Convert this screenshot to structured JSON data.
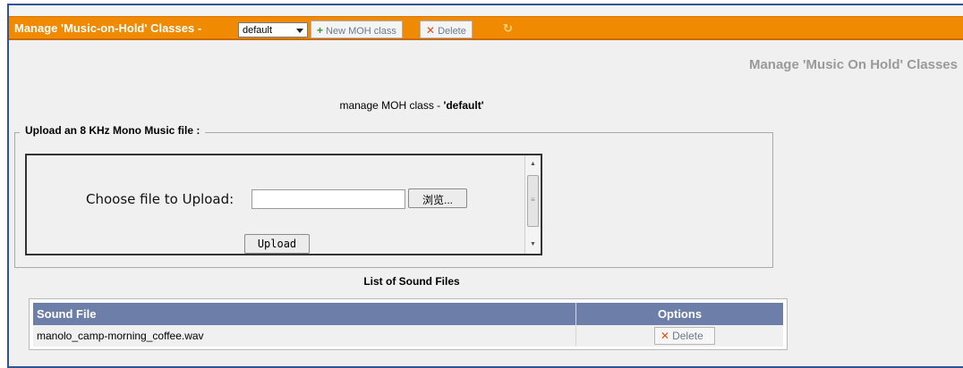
{
  "toolbar": {
    "title": "Manage 'Music-on-Hold' Classes -",
    "class_select_value": "default",
    "new_button": "New MOH class",
    "delete_button": "Delete"
  },
  "page": {
    "right_title": "Manage 'Music On Hold' Classes",
    "manage_prefix": "manage MOH class - ",
    "manage_class": "'default'"
  },
  "upload": {
    "legend": "Upload an 8 KHz Mono Music file :",
    "choose_label": "Choose file to Upload:",
    "file_value": "",
    "browse_label": "浏览...",
    "upload_label": "Upload"
  },
  "list": {
    "title": "List of Sound Files",
    "columns": [
      "Sound File",
      "Options"
    ],
    "rows": [
      {
        "file": "manolo_camp-morning_coffee.wav",
        "option": "Delete"
      }
    ]
  },
  "colors": {
    "toolbar": "#f08a00",
    "table_header": "#6d7fa8",
    "frame_border": "#2f5597"
  }
}
